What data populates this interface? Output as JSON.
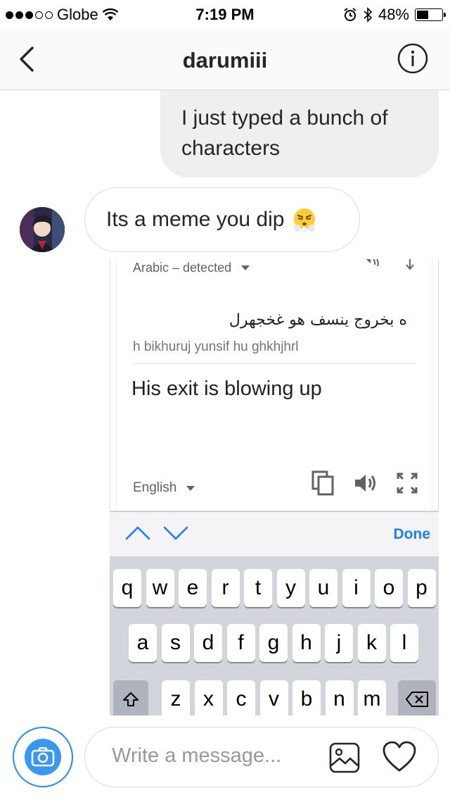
{
  "status_bar": {
    "carrier": "Globe",
    "time": "7:19 PM",
    "battery_percent": "48%",
    "battery_level": 0.48,
    "signal_bars_filled": 3,
    "signal_bars_total": 5
  },
  "header": {
    "title": "darumiii",
    "back_icon": "chevron-left-icon",
    "info_icon": "info-icon"
  },
  "messages": [
    {
      "direction": "outgoing",
      "text": "I just typed a bunch of characters"
    },
    {
      "direction": "incoming",
      "text": "Its a meme you dip",
      "emoji": "face-with-steam-from-nose"
    }
  ],
  "translation_card": {
    "source_language": "Arabic – detected",
    "source_text": "ه بخروج ينسف هو غخجهرل",
    "transliteration": "h bikhuruj yunsif hu ghkhjhrl",
    "translated_text": "His exit is blowing up",
    "target_language": "English",
    "icons": [
      "speaker-icon",
      "swap-icon",
      "copy-icon",
      "speaker-icon",
      "fullscreen-icon"
    ]
  },
  "keyboard": {
    "done_label": "Done",
    "row1": [
      "q",
      "w",
      "e",
      "r",
      "t",
      "y",
      "u",
      "i",
      "o",
      "p"
    ],
    "row2": [
      "a",
      "s",
      "d",
      "f",
      "g",
      "h",
      "j",
      "k",
      "l"
    ],
    "row3": [
      "z",
      "x",
      "c",
      "v",
      "b",
      "n",
      "m"
    ]
  },
  "composer": {
    "placeholder": "Write a message...",
    "accent_color": "#3897f0"
  }
}
